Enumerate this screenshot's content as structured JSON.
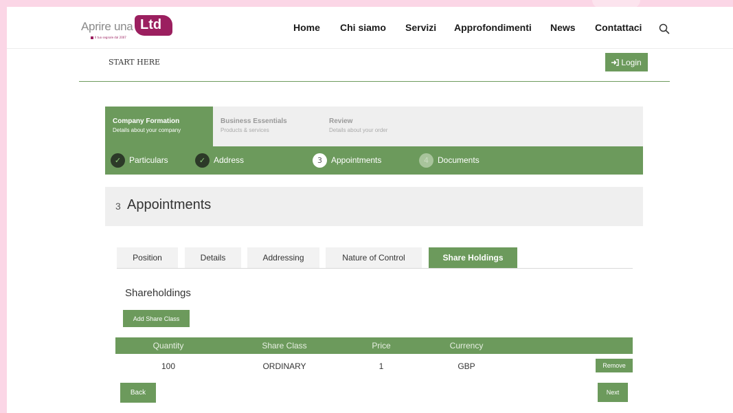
{
  "logo": {
    "text_left": "Aprire una",
    "text_badge": "Ltd",
    "tagline": "Il tuo segnale dal 2007"
  },
  "nav": {
    "items": [
      "Home",
      "Chi siamo",
      "Servizi",
      "Approfondimenti",
      "News",
      "Contattaci"
    ],
    "search_icon": "search-icon"
  },
  "subheader": {
    "start_here": "START HERE",
    "login_label": "Login",
    "login_icon": "sign-in-icon"
  },
  "stages": [
    {
      "title": "Company Formation",
      "subtitle": "Details about your company",
      "active": true
    },
    {
      "title": "Business Essentials",
      "subtitle": "Products & services",
      "active": false
    },
    {
      "title": "Review",
      "subtitle": "Details about your order",
      "active": false
    }
  ],
  "steps": [
    {
      "marker": "✓",
      "label": "Particulars",
      "state": "done"
    },
    {
      "marker": "✓",
      "label": "Address",
      "state": "done"
    },
    {
      "marker": "3",
      "label": "Appointments",
      "state": "current"
    },
    {
      "marker": "4",
      "label": "Documents",
      "state": "pending"
    }
  ],
  "section": {
    "number": "3",
    "title": "Appointments"
  },
  "tabs": [
    {
      "label": "Position",
      "active": false
    },
    {
      "label": "Details",
      "active": false
    },
    {
      "label": "Addressing",
      "active": false
    },
    {
      "label": "Nature of Control",
      "active": false
    },
    {
      "label": "Share Holdings",
      "active": true
    }
  ],
  "shareholdings": {
    "title": "Shareholdings",
    "add_label": "Add Share Class",
    "columns": [
      "Quantity",
      "Share Class",
      "Price",
      "Currency"
    ],
    "rows": [
      {
        "quantity": "100",
        "share_class": "ORDINARY",
        "price": "1",
        "currency": "GBP",
        "remove_label": "Remove"
      }
    ]
  },
  "footer": {
    "back_label": "Back",
    "next_label": "Next"
  },
  "colors": {
    "accent": "#6c9a5c",
    "brand": "#9b1f5f",
    "background": "#fbd6e6"
  }
}
